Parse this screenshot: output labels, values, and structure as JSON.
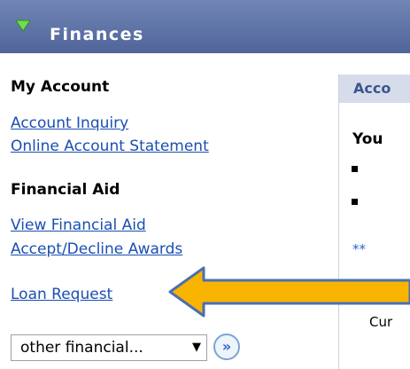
{
  "header": {
    "title": "Finances"
  },
  "left": {
    "my_account": {
      "title": "My Account",
      "links": [
        "Account Inquiry",
        "Online Account Statement"
      ]
    },
    "financial_aid": {
      "title": "Financial Aid",
      "links": [
        "View Financial Aid",
        "Accept/Decline Awards",
        "Loan Request"
      ]
    },
    "dropdown": {
      "value": "other financial..."
    }
  },
  "right": {
    "header": "Acco",
    "lines": [
      "You",
      "**",
      "Cur"
    ]
  },
  "colors": {
    "header_bg": "#5b70a6",
    "link": "#1a4fb2",
    "arrow_fill": "#f9b400",
    "arrow_stroke": "#4a6fb3"
  }
}
